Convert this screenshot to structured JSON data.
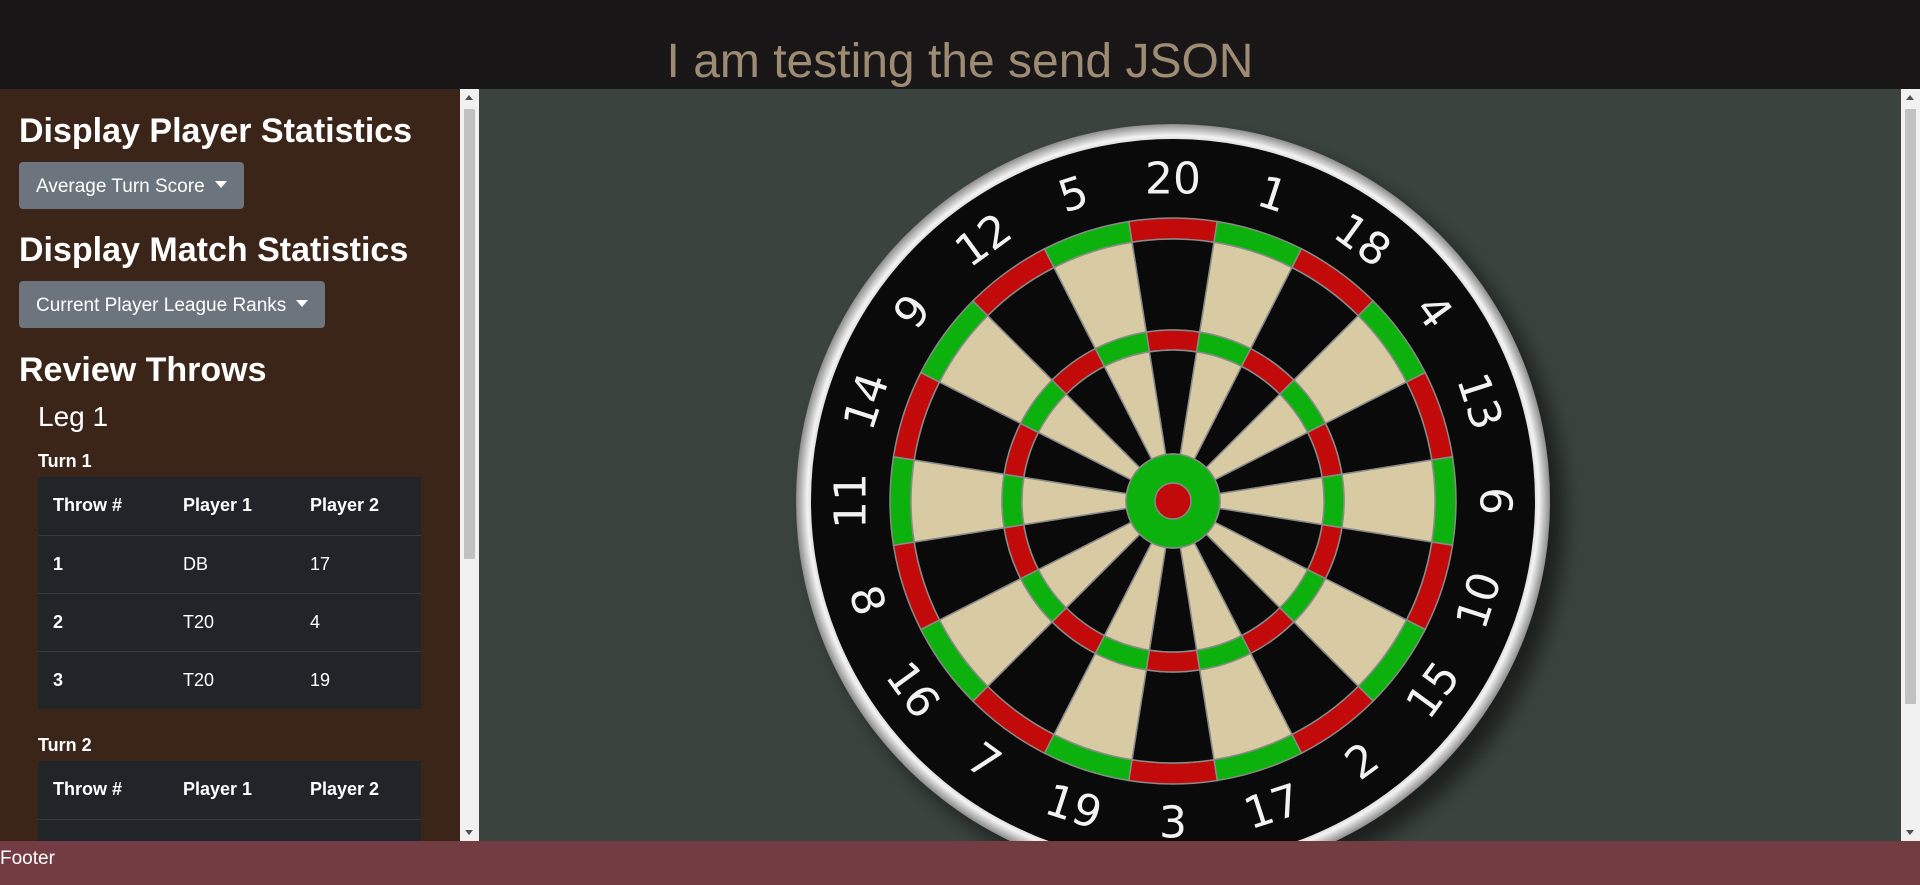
{
  "header": {
    "title": "I am testing the send JSON"
  },
  "sidebar": {
    "player_stats": {
      "heading": "Display Player Statistics",
      "dropdown_label": "Average Turn Score"
    },
    "match_stats": {
      "heading": "Display Match Statistics",
      "dropdown_label": "Current Player League Ranks"
    },
    "review": {
      "heading": "Review Throws",
      "leg_label": "Leg 1",
      "turns": [
        {
          "label": "Turn 1",
          "columns": [
            "Throw #",
            "Player 1",
            "Player 2"
          ],
          "rows": [
            [
              "1",
              "DB",
              "17"
            ],
            [
              "2",
              "T20",
              "4"
            ],
            [
              "3",
              "T20",
              "19"
            ]
          ]
        },
        {
          "label": "Turn 2",
          "columns": [
            "Throw #",
            "Player 1",
            "Player 2"
          ],
          "rows": []
        }
      ]
    }
  },
  "dartboard": {
    "numbers": [
      "20",
      "1",
      "18",
      "4",
      "13",
      "6",
      "10",
      "15",
      "2",
      "17",
      "3",
      "19",
      "7",
      "16",
      "8",
      "11",
      "14",
      "9",
      "12",
      "5"
    ],
    "colors": {
      "black": "#0a0a0a",
      "cream": "#d8cba3",
      "red": "#c20a0a",
      "green": "#0db10d",
      "rim": "#dcdcdc"
    }
  },
  "footer": {
    "label": "Footer"
  }
}
